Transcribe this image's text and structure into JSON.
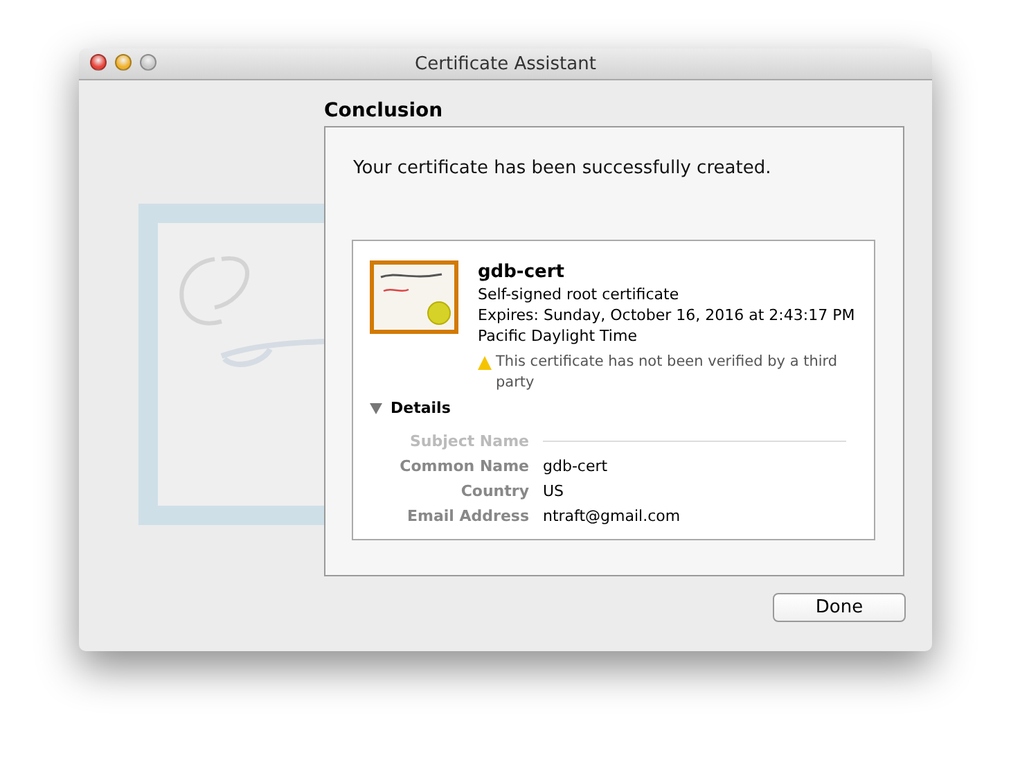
{
  "window": {
    "title": "Certificate Assistant"
  },
  "heading": "Conclusion",
  "message": "Your certificate has been successfully created.",
  "certificate": {
    "name": "gdb-cert",
    "type": "Self-signed root certificate",
    "expires": "Expires: Sunday, October 16, 2016 at 2:43:17 PM",
    "timezone": "Pacific Daylight Time",
    "warning": "This certificate has not been verified by a third party"
  },
  "details": {
    "label": "Details",
    "expanded": true,
    "fields": [
      {
        "kind": "section",
        "label": "Subject Name"
      },
      {
        "kind": "row",
        "label": "Common Name",
        "value": "gdb-cert"
      },
      {
        "kind": "row",
        "label": "Country",
        "value": "US"
      },
      {
        "kind": "row",
        "label": "Email Address",
        "value": "ntraft@gmail.com"
      }
    ]
  },
  "buttons": [
    {
      "label": "Done",
      "default": false
    }
  ]
}
